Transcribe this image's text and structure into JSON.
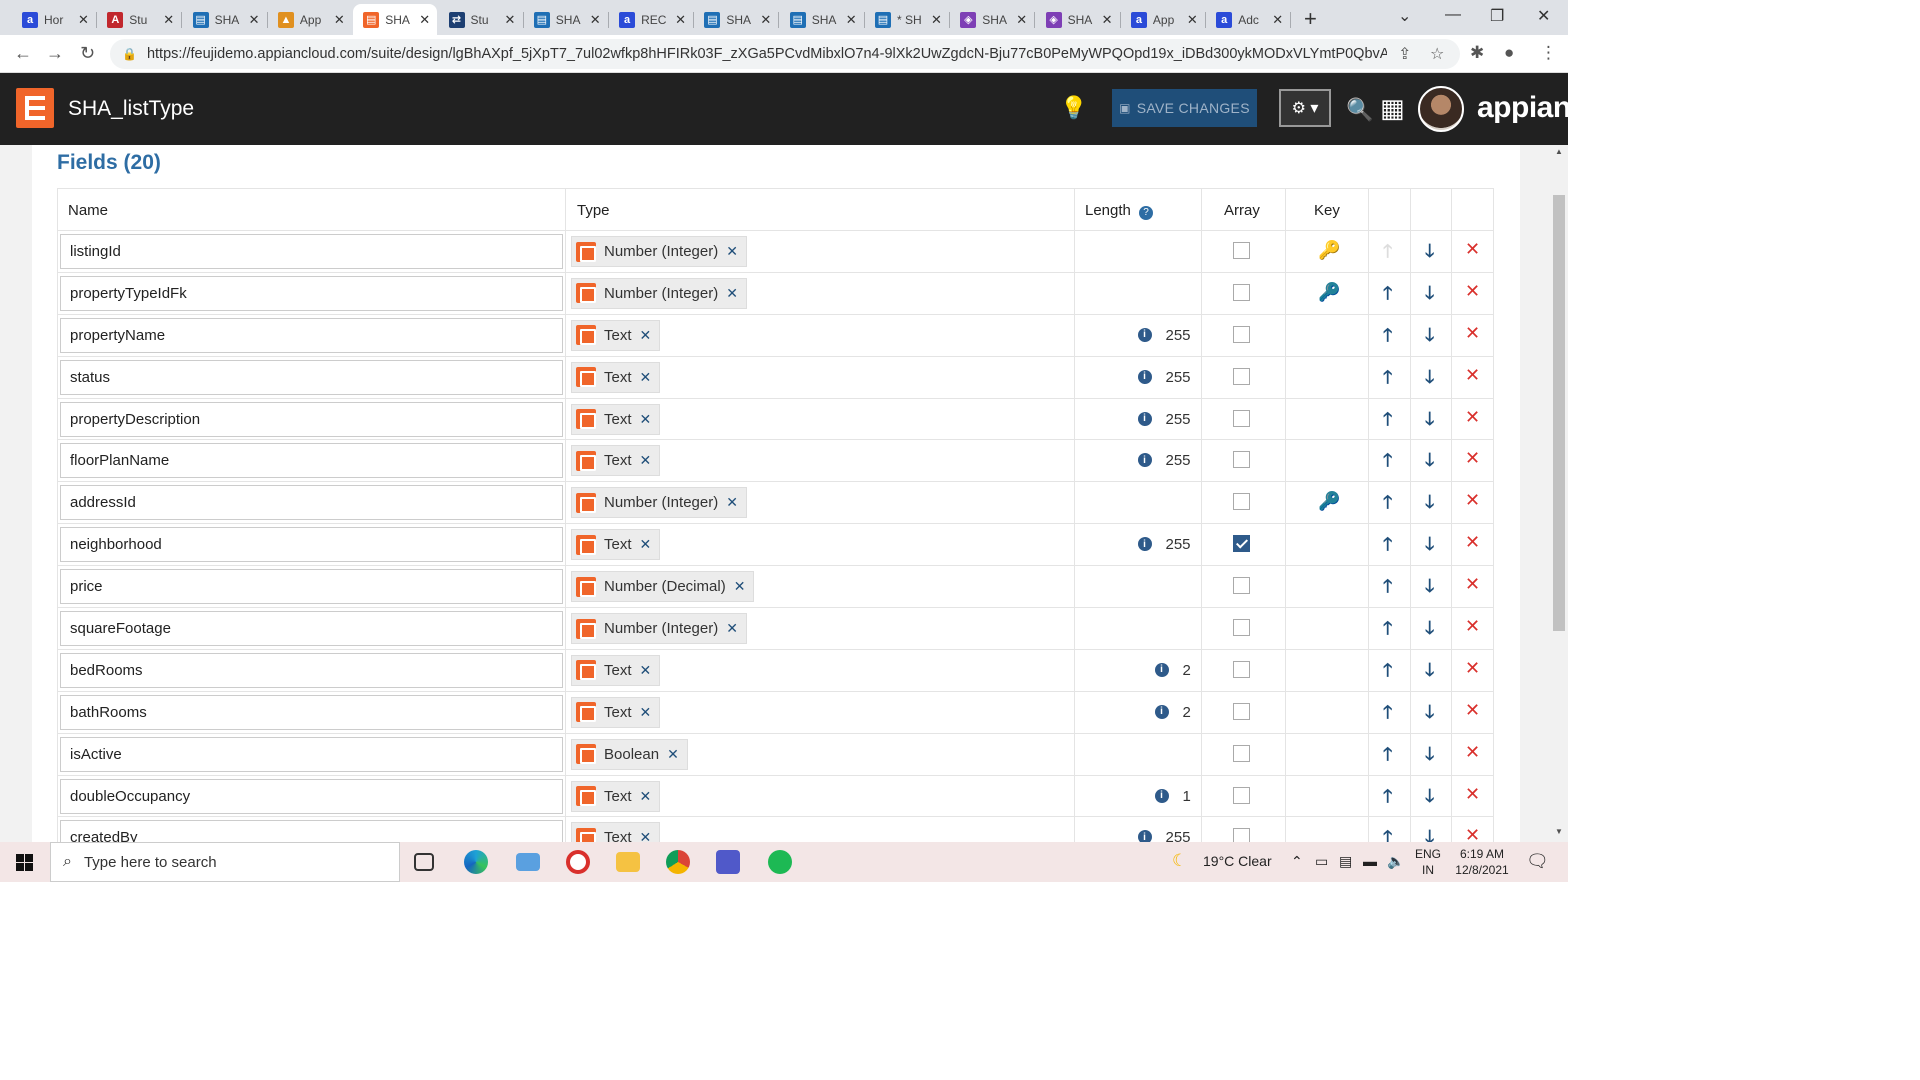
{
  "browser": {
    "tabs": [
      {
        "title": "Hor",
        "icon": "appian-a-icon",
        "color": "#2b4bd8"
      },
      {
        "title": "Stu",
        "icon": "pdf-icon",
        "color": "#c1272d"
      },
      {
        "title": "SHA",
        "icon": "designer-icon",
        "color": "#1f6fb5"
      },
      {
        "title": "App",
        "icon": "pma-icon",
        "color": "#e09020"
      },
      {
        "title": "SHA",
        "icon": "appian-logo-icon",
        "color": "#f0652a"
      },
      {
        "title": "Stu",
        "icon": "flow-icon",
        "color": "#1d3f72"
      },
      {
        "title": "SHA",
        "icon": "designer-icon",
        "color": "#1f6fb5"
      },
      {
        "title": "REC",
        "icon": "appian-a-icon",
        "color": "#2b4bd8"
      },
      {
        "title": "SHA",
        "icon": "designer-icon",
        "color": "#1f6fb5"
      },
      {
        "title": "SHA",
        "icon": "designer-icon",
        "color": "#1f6fb5"
      },
      {
        "title": "* SH",
        "icon": "designer-icon",
        "color": "#1f6fb5"
      },
      {
        "title": "SHA",
        "icon": "process-icon",
        "color": "#7e3fb5"
      },
      {
        "title": "SHA",
        "icon": "process-icon",
        "color": "#7e3fb5"
      },
      {
        "title": "App",
        "icon": "appian-a-icon",
        "color": "#2b4bd8"
      },
      {
        "title": "Adc",
        "icon": "appian-a-icon",
        "color": "#2b4bd8"
      }
    ],
    "url": "https://feujidemo.appiancloud.com/suite/design/lgBhAXpf_5jXpT7_7ul02wfkp8hHFIRk03F_zXGa5PCvdMibxlO7n4-9lXk2UwZgdcN-Bju77cB0PeMyWPQOpd19x_iDBd300ykMODxVLYmtP0QbvAwLWeR"
  },
  "header": {
    "title": "SHA_listType",
    "save_label": "SAVE CHANGES",
    "brand": "appian"
  },
  "fields_title": "Fields (20)",
  "columns": {
    "name": "Name",
    "type": "Type",
    "length": "Length",
    "array": "Array",
    "key": "Key"
  },
  "rows": [
    {
      "name": "listingId",
      "type": "Number (Integer)",
      "length": "",
      "array": false,
      "key": "primary"
    },
    {
      "name": "propertyTypeIdFk",
      "type": "Number (Integer)",
      "length": "",
      "array": false,
      "key": "foreign"
    },
    {
      "name": "propertyName",
      "type": "Text",
      "length": "255",
      "array": false,
      "key": ""
    },
    {
      "name": "status",
      "type": "Text",
      "length": "255",
      "array": false,
      "key": ""
    },
    {
      "name": "propertyDescription",
      "type": "Text",
      "length": "255",
      "array": false,
      "key": ""
    },
    {
      "name": "floorPlanName",
      "type": "Text",
      "length": "255",
      "array": false,
      "key": ""
    },
    {
      "name": "addressId",
      "type": "Number (Integer)",
      "length": "",
      "array": false,
      "key": "foreign"
    },
    {
      "name": "neighborhood",
      "type": "Text",
      "length": "255",
      "array": true,
      "key": ""
    },
    {
      "name": "price",
      "type": "Number (Decimal)",
      "length": "",
      "array": false,
      "key": ""
    },
    {
      "name": "squareFootage",
      "type": "Number (Integer)",
      "length": "",
      "array": false,
      "key": ""
    },
    {
      "name": "bedRooms",
      "type": "Text",
      "length": "2",
      "array": false,
      "key": ""
    },
    {
      "name": "bathRooms",
      "type": "Text",
      "length": "2",
      "array": false,
      "key": ""
    },
    {
      "name": "isActive",
      "type": "Boolean",
      "length": "",
      "array": false,
      "key": ""
    },
    {
      "name": "doubleOccupancy",
      "type": "Text",
      "length": "1",
      "array": false,
      "key": ""
    },
    {
      "name": "createdBy",
      "type": "Text",
      "length": "255",
      "array": false,
      "key": ""
    }
  ],
  "taskbar": {
    "search_placeholder": "Type here to search",
    "weather": "19°C  Clear",
    "lang_top": "ENG",
    "lang_bottom": "IN",
    "time": "6:19 AM",
    "date": "12/8/2021"
  }
}
